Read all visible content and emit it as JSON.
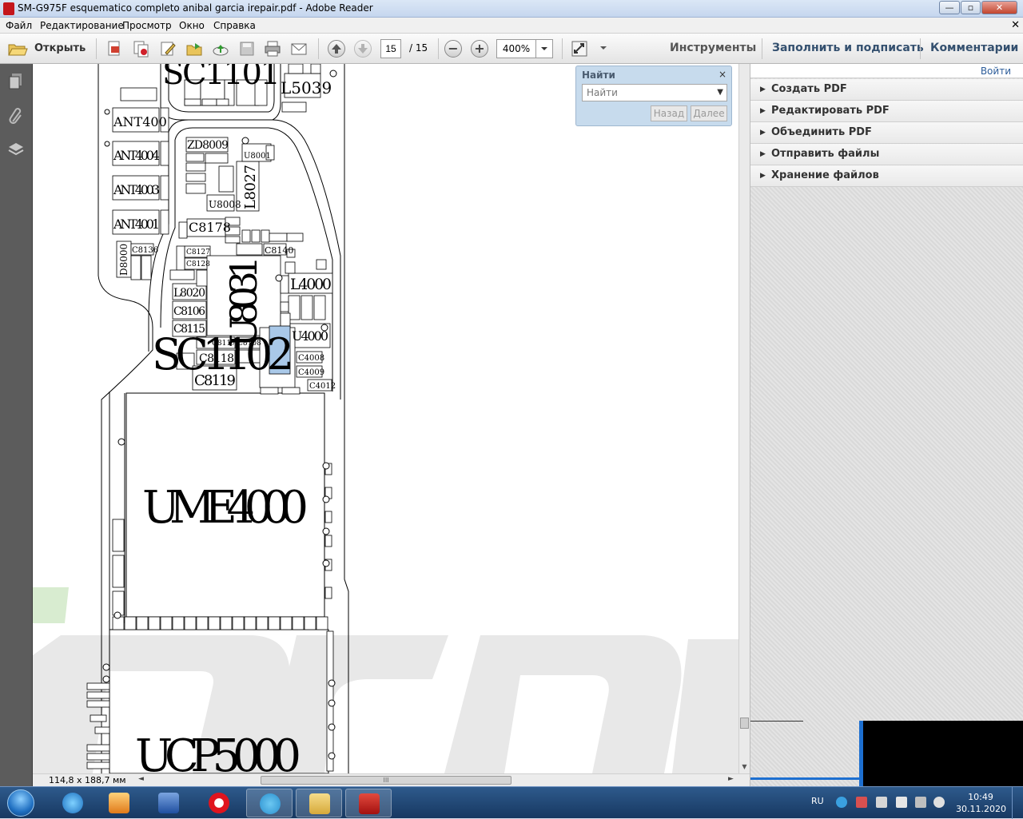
{
  "window": {
    "title": "SM-G975F esquematico completo anibal garcia irepair.pdf - Adobe Reader",
    "minimize": "—",
    "maximize": "▫",
    "close": "✕"
  },
  "menu": {
    "items": [
      "Файл",
      "Редактирование",
      "Просмотр",
      "Окно",
      "Справка"
    ],
    "close": "✕"
  },
  "toolbar": {
    "open_label": "Открыть",
    "page_current": "15",
    "page_total": "/ 15",
    "zoom_out": "−",
    "zoom_in": "+",
    "zoom_value": "400%",
    "tools_label": "Инструменты",
    "fill_sign_label": "Заполнить и подписать",
    "comments_label": "Комментарии"
  },
  "find": {
    "title": "Найти",
    "close": "×",
    "placeholder": "Найти",
    "back_label": "Назад",
    "next_label": "Далее"
  },
  "right_panel": {
    "login_label": "Войти",
    "items": [
      "Создать PDF",
      "Редактировать PDF",
      "Объединить PDF",
      "Отправить файлы",
      "Хранение файлов"
    ]
  },
  "status": {
    "page_size": "114,8 x 188,7 мм",
    "scroll_grip": "III"
  },
  "schematic": {
    "big_labels": [
      "UME4000",
      "UCP5000",
      "SC1101",
      "SC1102",
      "U8031"
    ],
    "labels": [
      "L5039",
      "ANT400",
      "ANT4004",
      "ANT4003",
      "ANT4001",
      "ZD8009",
      "L8027",
      "U8008",
      "C8178",
      "C8140",
      "L4000",
      "L8020",
      "C8106",
      "C8115",
      "C8118",
      "C8119",
      "U4000",
      "C4008",
      "C4009",
      "C4012",
      "C8136",
      "D8000",
      "U8001",
      "C8127",
      "C8128",
      "C8117",
      "C8108"
    ]
  },
  "tray": {
    "lang": "RU",
    "time": "10:49",
    "date": "30.11.2020"
  }
}
